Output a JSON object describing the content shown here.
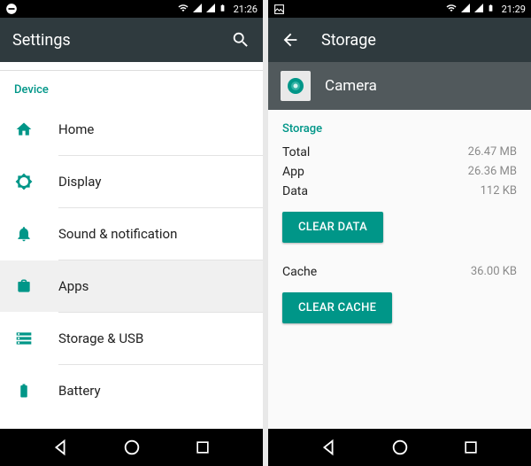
{
  "left": {
    "statusbar": {
      "time": "21:26"
    },
    "toolbar": {
      "title": "Settings"
    },
    "section_label": "Device",
    "items": [
      {
        "label": "Home"
      },
      {
        "label": "Display"
      },
      {
        "label": "Sound & notification"
      },
      {
        "label": "Apps"
      },
      {
        "label": "Storage & USB"
      },
      {
        "label": "Battery"
      }
    ]
  },
  "right": {
    "statusbar": {
      "time": "21:29"
    },
    "toolbar": {
      "title": "Storage"
    },
    "app": {
      "name": "Camera"
    },
    "section_label": "Storage",
    "rows": {
      "total_label": "Total",
      "total_value": "26.47 MB",
      "app_label": "App",
      "app_value": "26.36 MB",
      "data_label": "Data",
      "data_value": "112 KB",
      "cache_label": "Cache",
      "cache_value": "36.00 KB"
    },
    "buttons": {
      "clear_data": "CLEAR DATA",
      "clear_cache": "CLEAR CACHE"
    }
  }
}
